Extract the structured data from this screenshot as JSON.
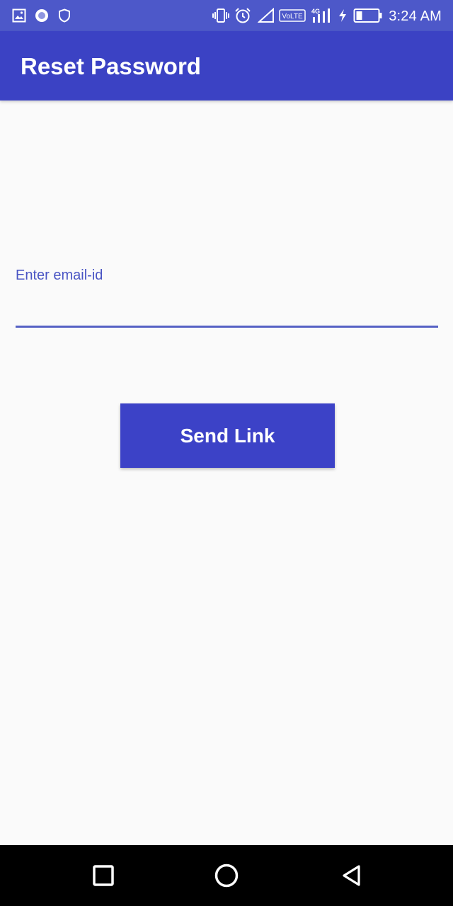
{
  "status_bar": {
    "time": "3:24 AM",
    "volte_label": "VoLTE",
    "network_label": "4G",
    "icons": [
      "image-icon",
      "record-icon",
      "shield-icon",
      "vibrate-icon",
      "alarm-icon",
      "signal-icon",
      "volte-icon",
      "network-4g-icon",
      "charging-icon",
      "battery-icon"
    ]
  },
  "app_bar": {
    "title": "Reset Password"
  },
  "form": {
    "email_label": "Enter email-id",
    "email_value": "",
    "send_button_label": "Send Link"
  },
  "nav_bar": {
    "icons": [
      "recents-icon",
      "home-icon",
      "back-icon"
    ]
  },
  "colors": {
    "status_bar": "#4d58c9",
    "app_bar": "#3b42c4",
    "accent": "#4a55c4",
    "button": "#3c42c7",
    "background": "#fafafa"
  }
}
